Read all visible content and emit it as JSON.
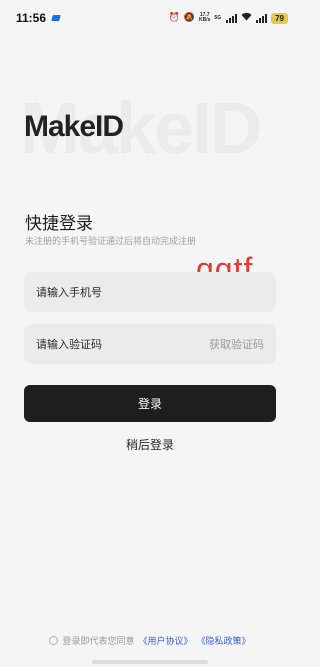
{
  "status_bar": {
    "time": "11:56",
    "net_speed_value": "17.7",
    "net_speed_unit": "KB/s",
    "signal_label": "5G",
    "battery": "79"
  },
  "brand": {
    "logo": "MakeID",
    "watermark": "MakeID"
  },
  "login": {
    "title": "快捷登录",
    "subtitle": "未注册的手机号验证通过后将自动完成注册",
    "phone_placeholder": "请输入手机号",
    "code_placeholder": "请输入验证码",
    "get_code_label": "获取验证码",
    "login_button": "登录",
    "later_link": "稍后登录"
  },
  "overlay": {
    "handwriting": "qqtf"
  },
  "agreement": {
    "prefix": "登录即代表您同意",
    "user_agreement": "《用户协议》",
    "privacy_policy": "《隐私政策》"
  },
  "colors": {
    "background": "#f5f5f5",
    "button_bg": "#1e1e1e",
    "link": "#3b5bdb",
    "handwriting": "#e53935",
    "battery": "#e8c84a"
  }
}
